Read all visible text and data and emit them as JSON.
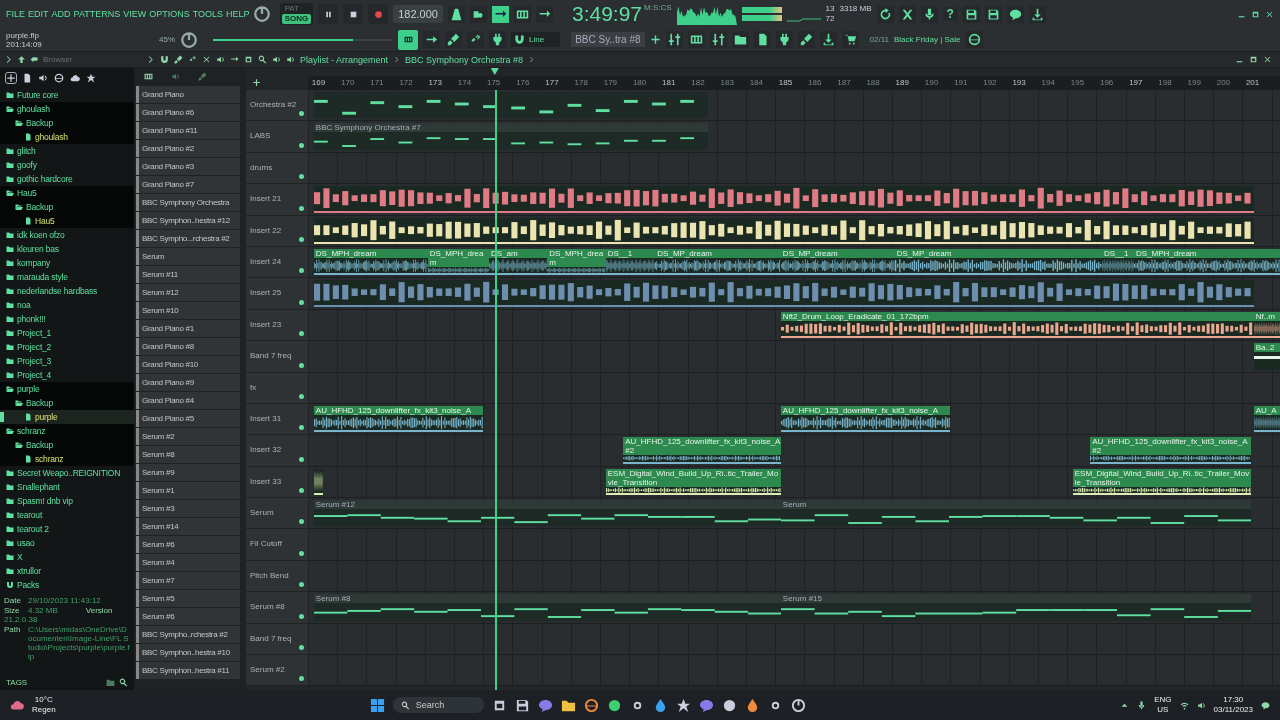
{
  "menu": [
    "FILE",
    "EDIT",
    "ADD",
    "PATTERNS",
    "VIEW",
    "OPTIONS",
    "TOOLS",
    "HELP"
  ],
  "project": {
    "file": "purple.flp",
    "position": "201:14:09",
    "zoom": "45%"
  },
  "transport": {
    "modes": [
      {
        "label": "PAT",
        "selected": false
      },
      {
        "label": "SONG",
        "selected": true
      }
    ],
    "tempo": "182.000",
    "time": "3:49:97",
    "time_unit": "M:S:CS",
    "master_volume": {
      "level": 0.78
    }
  },
  "monitor": {
    "polyphony": "13",
    "memory": "3318 MB",
    "cpu": "72"
  },
  "help_label": "?",
  "toolbar": {
    "snap": "Line",
    "pattern": "BBC Sy..tra #8",
    "news_date": "02/11",
    "news_text": "Black Friday | Sale"
  },
  "browser": {
    "title": "Browser",
    "tree": [
      {
        "label": "Future core",
        "kind": "folder",
        "expanded": false,
        "selected": false
      },
      {
        "label": "ghoulash",
        "kind": "folder",
        "expanded": true,
        "selected": false,
        "children": [
          {
            "label": "Backup",
            "kind": "folder",
            "expanded": true,
            "selected": false,
            "children": [
              {
                "label": "ghoulash",
                "kind": "file",
                "selected": false
              }
            ]
          }
        ]
      },
      {
        "label": "glitch",
        "kind": "folder",
        "expanded": false,
        "selected": false
      },
      {
        "label": "goofy",
        "kind": "folder",
        "expanded": false,
        "selected": false
      },
      {
        "label": "gothic hardcore",
        "kind": "folder",
        "expanded": false,
        "selected": false
      },
      {
        "label": "Hau5",
        "kind": "folder",
        "expanded": true,
        "selected": false,
        "children": [
          {
            "label": "Backup",
            "kind": "folder",
            "expanded": true,
            "selected": false,
            "children": [
              {
                "label": "Hau5",
                "kind": "file",
                "selected": false
              }
            ]
          }
        ]
      },
      {
        "label": "idk koen ofzo",
        "kind": "folder",
        "expanded": false,
        "selected": false
      },
      {
        "label": "kleuren bas",
        "kind": "folder",
        "expanded": false,
        "selected": false
      },
      {
        "label": "kompany",
        "kind": "folder",
        "expanded": false,
        "selected": false
      },
      {
        "label": "marauda style",
        "kind": "folder",
        "expanded": false,
        "selected": false
      },
      {
        "label": "nederlandse hardbass",
        "kind": "folder",
        "expanded": false,
        "selected": false
      },
      {
        "label": "noa",
        "kind": "folder",
        "expanded": false,
        "selected": false
      },
      {
        "label": "phonk!!!",
        "kind": "folder",
        "expanded": false,
        "selected": false
      },
      {
        "label": "Project_1",
        "kind": "folder",
        "expanded": false,
        "selected": false
      },
      {
        "label": "Project_2",
        "kind": "folder",
        "expanded": false,
        "selected": false
      },
      {
        "label": "Project_3",
        "kind": "folder",
        "expanded": false,
        "selected": false
      },
      {
        "label": "Project_4",
        "kind": "folder",
        "expanded": false,
        "selected": false
      },
      {
        "label": "purple",
        "kind": "folder",
        "expanded": true,
        "selected": false,
        "children": [
          {
            "label": "Backup",
            "kind": "folder",
            "expanded": true,
            "selected": false,
            "children": [
              {
                "label": "purple",
                "kind": "file",
                "selected": true
              }
            ]
          }
        ]
      },
      {
        "label": "schranz",
        "kind": "folder",
        "expanded": true,
        "selected": false,
        "children": [
          {
            "label": "Backup",
            "kind": "folder",
            "expanded": true,
            "selected": false,
            "children": [
              {
                "label": "schranz",
                "kind": "file",
                "selected": false
              }
            ]
          }
        ]
      },
      {
        "label": "Secret Weapo..REIGNITION",
        "kind": "folder",
        "expanded": false,
        "selected": false
      },
      {
        "label": "Snallephant",
        "kind": "folder",
        "expanded": false,
        "selected": false
      },
      {
        "label": "Spasm! dnb vip",
        "kind": "folder",
        "expanded": false,
        "selected": false
      },
      {
        "label": "tearout",
        "kind": "folder",
        "expanded": false,
        "selected": false
      },
      {
        "label": "tearout 2",
        "kind": "folder",
        "expanded": false,
        "selected": false
      },
      {
        "label": "usao",
        "kind": "folder",
        "expanded": false,
        "selected": false
      },
      {
        "label": "X",
        "kind": "folder",
        "expanded": false,
        "selected": false
      },
      {
        "label": "xtrullor",
        "kind": "folder",
        "expanded": false,
        "selected": false
      },
      {
        "label": "Packs",
        "kind": "pack",
        "expanded": false,
        "selected": false
      }
    ],
    "info": [
      {
        "key": "Date",
        "value": "29/10/2023 11:43:12"
      },
      {
        "key": "Size",
        "value": "4.32 MB",
        "extra_key": "Version",
        "extra_value": "21.2.0.38"
      },
      {
        "key": "Path",
        "value": "C:\\Users\\midas\\OneDrive\\Documenten\\Image-Line\\FL Studio\\Projects\\purple\\purple.flp"
      }
    ],
    "tags": "TAGS"
  },
  "patterns": [
    "Grand Piano",
    "Grand Piano #6",
    "Grand Piano #11",
    "Grand Piano #2",
    "Grand Piano #3",
    "Grand Piano #7",
    "BBC Symphony Orchestra",
    "BBC Symphon..hestra #12",
    "BBC Sympho...rchestra #2",
    "Serum",
    "Serum #11",
    "Serum #12",
    "Serum #10",
    "Grand Piano #1",
    "Grand Piano #8",
    "Grand Piano #10",
    "Grand Piano #9",
    "Grand Piano #4",
    "Grand Piano #5",
    "Serum #2",
    "Serum #8",
    "Serum #9",
    "Serum #1",
    "Serum #3",
    "Serum #14",
    "Serum #6",
    "Serum #4",
    "Serum #7",
    "Serum #5",
    "Serum #6",
    "BBC Sympho..rchestra #2",
    "BBC Symphon..hestra #10",
    "BBC Symphon..hestra #11"
  ],
  "playlist": {
    "title": "Playlist - Arrangement",
    "pattern": "BBC Symphony Orchestra #8",
    "ruler": [
      "169",
      "170",
      "171",
      "172",
      "173",
      "174",
      "175",
      "176",
      "177",
      "178",
      "179",
      "180",
      "181",
      "182",
      "183",
      "184",
      "185",
      "186",
      "187",
      "188",
      "189",
      "190",
      "191",
      "192",
      "193",
      "194",
      "195",
      "196",
      "197",
      "198",
      "199",
      "200",
      "201"
    ],
    "tracks": [
      {
        "name": "Orchestra #2",
        "clips": [
          {
            "kind": "notes"
          }
        ]
      },
      {
        "name": "LABS",
        "clips": [
          {
            "kind": "notes",
            "label": "BBC Symphony Orchestra #7"
          }
        ]
      },
      {
        "name": "drums"
      },
      {
        "name": "Insert 21",
        "clips": [
          {
            "kind": "audio",
            "color": "#e07a84"
          }
        ]
      },
      {
        "name": "Insert 22",
        "clips": [
          {
            "kind": "audio",
            "color": "#ece4b0"
          }
        ]
      },
      {
        "name": "Insert 24",
        "clips": [
          {
            "kind": "audio",
            "color": "#7ab4cc",
            "label": "DS_MPH_dream"
          },
          {
            "kind": "audio",
            "color": "#7ab4cc",
            "label": "DS_MPH_dream"
          },
          {
            "kind": "audio",
            "color": "#7ab4cc",
            "label": "DS_am"
          },
          {
            "kind": "audio",
            "color": "#7ab4cc",
            "label": "DS_MPH_dream"
          },
          {
            "kind": "audio",
            "color": "#7ab4cc",
            "label": "DS__1"
          },
          {
            "kind": "audio",
            "color": "#7ab4cc",
            "label": "DS_MP_dream"
          },
          {
            "kind": "audio",
            "color": "#7ab4cc",
            "label": "DS_MP_dream"
          },
          {
            "kind": "audio",
            "color": "#7ab4cc",
            "label": "DS_MP_dream"
          },
          {
            "kind": "audio",
            "color": "#7ab4cc",
            "label": "DS__1"
          },
          {
            "kind": "audio",
            "color": "#7ab4cc",
            "label": "DS_MPH_dream"
          }
        ]
      },
      {
        "name": "Insert 25",
        "clips": [
          {
            "kind": "audio",
            "color": "#6e8eb0"
          }
        ]
      },
      {
        "name": "Insert 23",
        "clips": [
          {
            "kind": "audio",
            "color": "#eaa890",
            "label": "Nft2_Drum_Loop_Eradicate_01_172bpm"
          },
          {
            "kind": "audio",
            "color": "#eaa890",
            "label": "Nf..m"
          }
        ]
      },
      {
        "name": "Band 7 freq",
        "clips": [
          {
            "kind": "automation",
            "label": "Ba..2"
          }
        ]
      },
      {
        "name": "fx"
      },
      {
        "name": "Insert 31",
        "clips": [
          {
            "kind": "audio",
            "color": "#7ab4cc",
            "label": "AU_HFHD_125_downlifter_fx_kit3_noise_A"
          },
          {
            "kind": "audio",
            "color": "#7ab4cc",
            "label": "AU_HFHD_125_downlifter_fx_kit3_noise_A"
          },
          {
            "kind": "audio",
            "color": "#7ab4cc",
            "label": "AU_A"
          }
        ]
      },
      {
        "name": "Insert 32",
        "clips": [
          {
            "kind": "audio",
            "color": "#7ab4cc",
            "label": "AU_HFHD_125_downlifter_fx_kit3_noise_A #2"
          },
          {
            "kind": "audio",
            "color": "#7ab4cc",
            "label": "AU_HFHD_125_downlifter_fx_kit3_noise_A #2"
          }
        ]
      },
      {
        "name": "Insert 33",
        "clips": [
          {
            "kind": "audio",
            "color": "#dcecb4"
          },
          {
            "kind": "audio",
            "color": "#dcecb4",
            "label": "ESM_Digital_Wind_Build_Up_Ri..tic_Trailer_Movie_Transition"
          },
          {
            "kind": "audio",
            "color": "#dcecb4",
            "label": "ESM_Digital_Wind_Build_Up_Ri..tic_Trailer_Movie_Transition"
          }
        ]
      },
      {
        "name": "Serum",
        "clips": [
          {
            "kind": "notes",
            "label": "Serum #12"
          },
          {
            "kind": "notes",
            "label": "Serum"
          }
        ]
      },
      {
        "name": "Fil Cutoff"
      },
      {
        "name": "Pitch Bend"
      },
      {
        "name": "Serum #8",
        "clips": [
          {
            "kind": "notes",
            "label": "Serum #8"
          },
          {
            "kind": "notes",
            "label": "Serum #15"
          }
        ]
      },
      {
        "name": "Band 7 freq"
      },
      {
        "name": "Serum #2"
      }
    ]
  },
  "taskbar": {
    "temperature": "10°C",
    "weather": "Regen",
    "search": "Search",
    "language": "ENG",
    "region": "US",
    "time": "17:30",
    "date": "03/11/2023"
  }
}
